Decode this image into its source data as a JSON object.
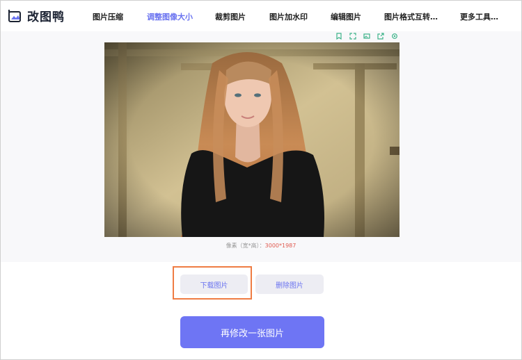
{
  "brand": {
    "name": "改图鸭"
  },
  "nav": {
    "items": [
      {
        "label": "图片压缩",
        "active": false
      },
      {
        "label": "调整图像大小",
        "active": true
      },
      {
        "label": "裁剪图片",
        "active": false
      },
      {
        "label": "图片加水印",
        "active": false
      },
      {
        "label": "编辑图片",
        "active": false
      },
      {
        "label": "图片格式互转…",
        "active": false
      },
      {
        "label": "更多工具…",
        "active": false
      }
    ]
  },
  "preview": {
    "toolbar_icons": [
      "bookmark-icon",
      "fullscreen-icon",
      "image-icon",
      "share-icon",
      "settings-icon"
    ],
    "pixel_label": "像素（宽*高）：",
    "pixel_value": "3000*1987"
  },
  "actions": {
    "download": "下载图片",
    "delete": "删除图片",
    "modify_another": "再修改一张图片"
  },
  "colors": {
    "accent": "#6a73f0",
    "primary_button": "#6e75f4",
    "highlight_box": "#ef7c43",
    "pixel_value": "#e05a4f"
  }
}
